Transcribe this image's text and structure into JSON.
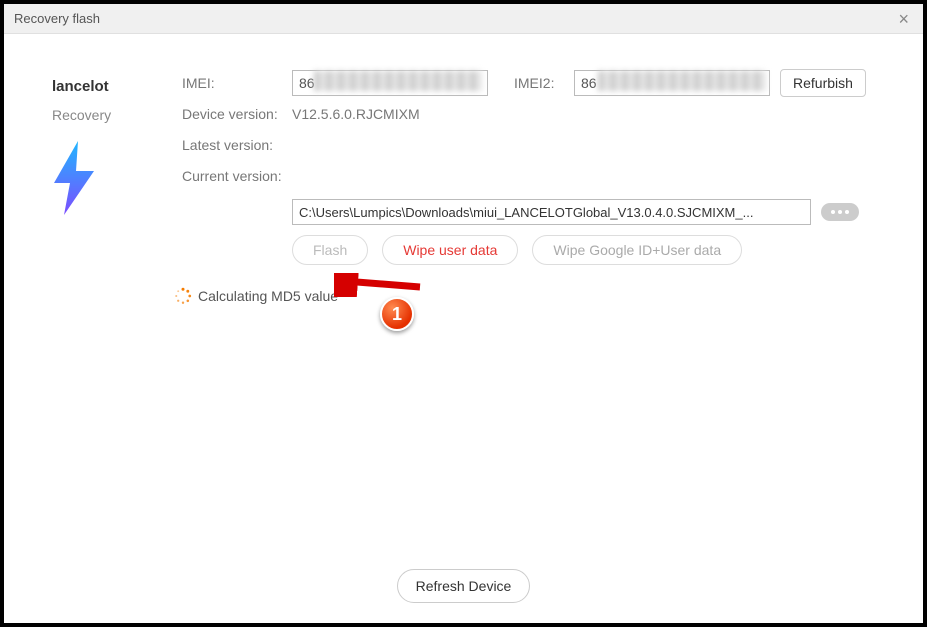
{
  "window": {
    "title": "Recovery flash"
  },
  "device": {
    "name": "lancelot",
    "mode": "Recovery"
  },
  "labels": {
    "imei": "IMEI:",
    "imei2": "IMEI2:",
    "device_version": "Device version:",
    "latest_version": "Latest version:",
    "current_version": "Current version:"
  },
  "values": {
    "imei_prefix": "86",
    "imei2_prefix": "86",
    "device_version": "V12.5.6.0.RJCMIXM",
    "latest_version": "",
    "current_version_path": "C:\\Users\\Lumpics\\Downloads\\miui_LANCELOTGlobal_V13.0.4.0.SJCMIXM_..."
  },
  "buttons": {
    "refurbish": "Refurbish",
    "flash": "Flash",
    "wipe_user": "Wipe user data",
    "wipe_google": "Wipe Google ID+User data",
    "refresh": "Refresh Device"
  },
  "status": {
    "text": "Calculating MD5 value"
  },
  "annotation": {
    "badge": "1"
  },
  "colors": {
    "accent_red": "#e53935",
    "spinner": "#f57c00",
    "bolt_top": "#1fb6ff",
    "bolt_bottom": "#7c4dff"
  }
}
